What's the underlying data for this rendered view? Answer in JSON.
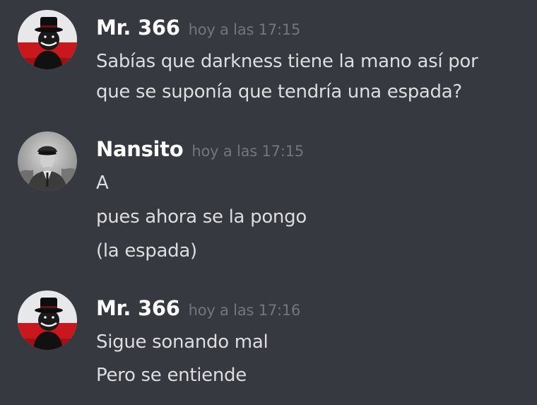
{
  "messages": [
    {
      "author": "Mr. 366",
      "timestamp": "hoy a las 17:15",
      "avatar_icon": "masked-figure-avatar",
      "lines": [
        "Sabías que darkness tiene la mano así por",
        "que se suponía que tendría una espada?"
      ]
    },
    {
      "author": "Nansito",
      "timestamp": "hoy a las 17:15",
      "avatar_icon": "uniformed-man-photo-avatar",
      "lines": [
        "A",
        "pues ahora se la pongo",
        "(la espada)"
      ]
    },
    {
      "author": "Mr. 366",
      "timestamp": "hoy a las 17:16",
      "avatar_icon": "masked-figure-avatar",
      "lines": [
        "Sigue sonando mal",
        "Pero se entiende"
      ]
    }
  ],
  "colors": {
    "background": "#36393f",
    "username": "#ffffff",
    "timestamp": "#72767d",
    "text": "#dcddde"
  }
}
